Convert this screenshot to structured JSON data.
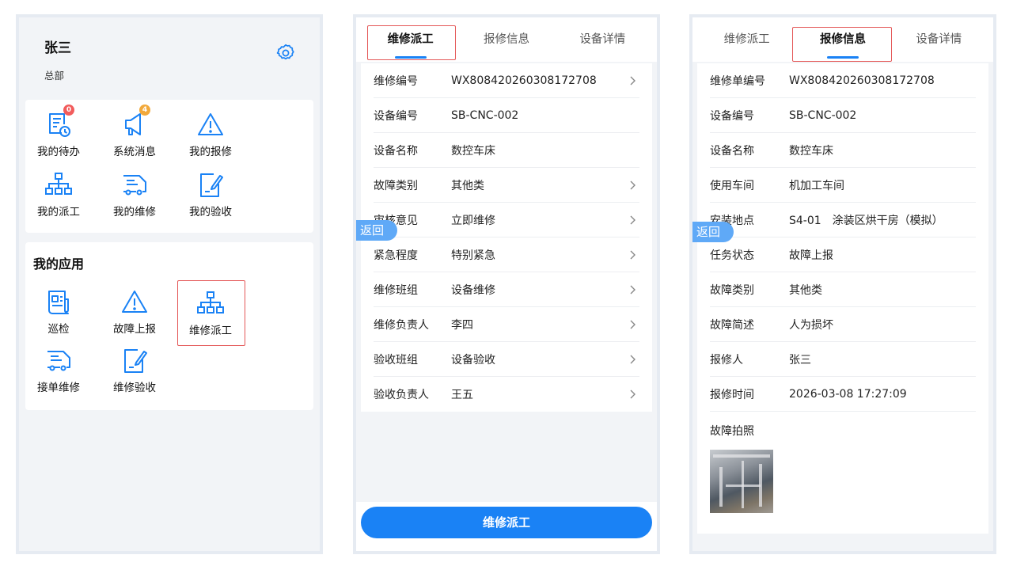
{
  "phone1": {
    "user_name": "张三",
    "org": "总部",
    "settings_icon": "gear-icon",
    "top_grid": [
      {
        "label": "我的待办",
        "icon": "todo-clock-icon",
        "badge": "0",
        "badge_color": "#f25c5c"
      },
      {
        "label": "系统消息",
        "icon": "megaphone-icon",
        "badge": "4",
        "badge_color": "#f2a93b"
      },
      {
        "label": "我的报修",
        "icon": "warning-triangle-icon"
      },
      {
        "label": "我的派工",
        "icon": "org-tree-icon"
      },
      {
        "label": "我的维修",
        "icon": "truck-icon"
      },
      {
        "label": "我的验收",
        "icon": "edit-document-icon"
      }
    ],
    "apps_title": "我的应用",
    "apps": [
      {
        "label": "巡检",
        "icon": "inspection-document-icon"
      },
      {
        "label": "故障上报",
        "icon": "warning-triangle-icon"
      },
      {
        "label": "维修派工",
        "icon": "org-tree-icon"
      },
      {
        "label": "接单维修",
        "icon": "truck-icon"
      },
      {
        "label": "维修验收",
        "icon": "edit-document-icon"
      }
    ]
  },
  "phone2": {
    "tabs": [
      "维修派工",
      "报修信息",
      "设备详情"
    ],
    "active_tab": "维修派工",
    "rows": [
      {
        "key": "维修编号",
        "value": "WX808420260308172708",
        "chevron": true
      },
      {
        "key": "设备编号",
        "value": "SB-CNC-002",
        "chevron": false
      },
      {
        "key": "设备名称",
        "value": "数控车床",
        "chevron": false
      },
      {
        "key": "故障类别",
        "value": "其他类",
        "chevron": true
      },
      {
        "key": "审核意见",
        "value": "立即维修",
        "chevron": true
      },
      {
        "key": "紧急程度",
        "value": "特别紧急",
        "chevron": true
      },
      {
        "key": "维修班组",
        "value": "设备维修",
        "chevron": true
      },
      {
        "key": "维修负责人",
        "value": "李四",
        "chevron": true
      },
      {
        "key": "验收班组",
        "value": "设备验收",
        "chevron": true
      },
      {
        "key": "验收负责人",
        "value": "王五",
        "chevron": true
      }
    ],
    "submit_label": "维修派工",
    "back_label": "返回"
  },
  "phone3": {
    "tabs": [
      "维修派工",
      "报修信息",
      "设备详情"
    ],
    "active_tab": "报修信息",
    "rows": [
      {
        "key": "维修单编号",
        "value": "WX808420260308172708"
      },
      {
        "key": "设备编号",
        "value": "SB-CNC-002"
      },
      {
        "key": "设备名称",
        "value": "数控车床"
      },
      {
        "key": "使用车间",
        "value": "机加工车间"
      },
      {
        "key": "安装地点",
        "value": "S4-01　涂装区烘干房（模拟）"
      },
      {
        "key": "任务状态",
        "value": "故障上报"
      },
      {
        "key": "故障类别",
        "value": "其他类"
      },
      {
        "key": "故障简述",
        "value": "人为损坏"
      },
      {
        "key": "报修人",
        "value": "张三"
      },
      {
        "key": "报修时间",
        "value": "2026-03-08 17:27:09"
      }
    ],
    "photo_label": "故障拍照",
    "back_label": "返回"
  },
  "colors": {
    "accent": "#1a82f5",
    "highlight": "#e45858",
    "back_button": "#5fa9f7"
  }
}
